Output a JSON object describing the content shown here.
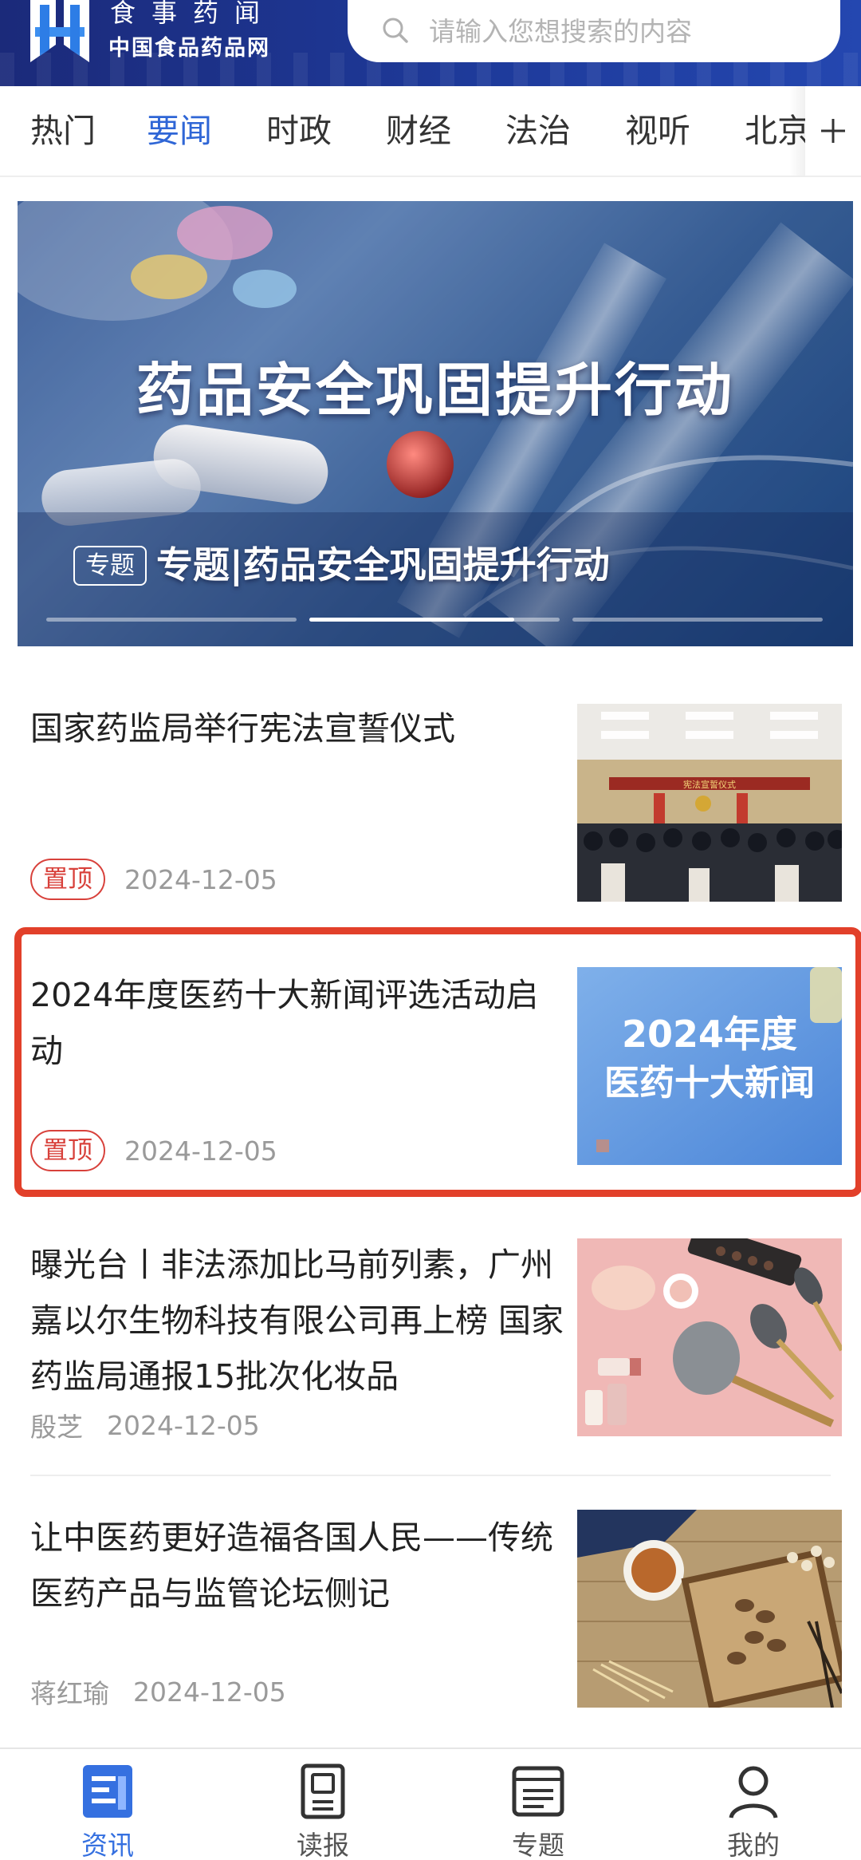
{
  "header": {
    "logo_line1": "食事药闻",
    "logo_line2": "中国食品药品网",
    "search_placeholder": "请输入您想搜索的内容"
  },
  "tabs": {
    "items": [
      {
        "label": "热门",
        "active": false
      },
      {
        "label": "要闻",
        "active": true
      },
      {
        "label": "时政",
        "active": false
      },
      {
        "label": "财经",
        "active": false
      },
      {
        "label": "法治",
        "active": false
      },
      {
        "label": "视听",
        "active": false
      },
      {
        "label": "北京",
        "active": false
      }
    ],
    "add_icon": "plus-icon"
  },
  "banner": {
    "headline": "药品安全巩固提升行动",
    "tag": "专题",
    "caption": "专题|药品安全巩固提升行动",
    "pager": {
      "count": 3,
      "active_index": 1,
      "active_progress": 0.82
    }
  },
  "articles": [
    {
      "title": "国家药监局举行宪法宣誓仪式",
      "badge": "置顶",
      "author": "",
      "date": "2024-12-05",
      "thumb_banner_text": "宪法宣誓仪式"
    },
    {
      "title": "2024年度医药十大新闻评选活动启动",
      "badge": "置顶",
      "author": "",
      "date": "2024-12-05",
      "thumb_line1": "2024年度",
      "thumb_line2": "医药十大新闻",
      "highlighted": true
    },
    {
      "title": "曝光台丨非法添加比马前列素，广州嘉以尔生物科技有限公司再上榜 国家药监局通报15批次化妆品",
      "badge": "",
      "author": "殷芝",
      "date": "2024-12-05"
    },
    {
      "title": "让中医药更好造福各国人民——传统医药产品与监管论坛侧记",
      "badge": "",
      "author": "蒋红瑜",
      "date": "2024-12-05"
    }
  ],
  "bottom_nav": [
    {
      "label": "资讯",
      "icon": "news-icon",
      "active": true
    },
    {
      "label": "读报",
      "icon": "newspaper-icon",
      "active": false
    },
    {
      "label": "专题",
      "icon": "topics-icon",
      "active": false
    },
    {
      "label": "我的",
      "icon": "user-icon",
      "active": false
    }
  ],
  "colors": {
    "header_bg": "#1e3a9a",
    "accent": "#2f66d6",
    "pin_red": "#d8413b",
    "highlight_red": "#e2402a"
  }
}
